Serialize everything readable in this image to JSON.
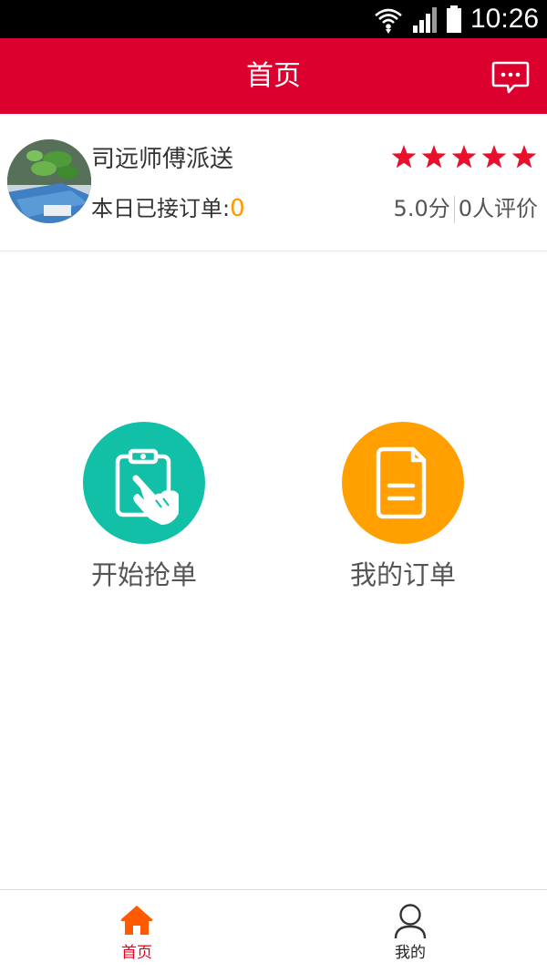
{
  "status_bar": {
    "time": "10:26",
    "icons": [
      "wifi-icon",
      "signal-icon",
      "battery-icon"
    ]
  },
  "header": {
    "title": "首页",
    "message_icon": "message-icon",
    "background": "#db002d"
  },
  "profile": {
    "name": "司远师傅派送",
    "orders_label": "本日已接订单:",
    "orders_count": "0",
    "stars": 5,
    "score": "5.0分",
    "reviews": "0人评价",
    "star_color": "#e8102a"
  },
  "actions": {
    "grab": {
      "label": "开始抢单",
      "icon": "clipboard-hand-icon",
      "color": "#12bfa7"
    },
    "orders": {
      "label": "我的订单",
      "icon": "document-icon",
      "color": "#ff9f00"
    }
  },
  "bottom_nav": {
    "home": {
      "label": "首页",
      "icon": "home-icon",
      "active": true,
      "color": "#ff5a00"
    },
    "me": {
      "label": "我的",
      "icon": "user-icon",
      "active": false
    }
  }
}
